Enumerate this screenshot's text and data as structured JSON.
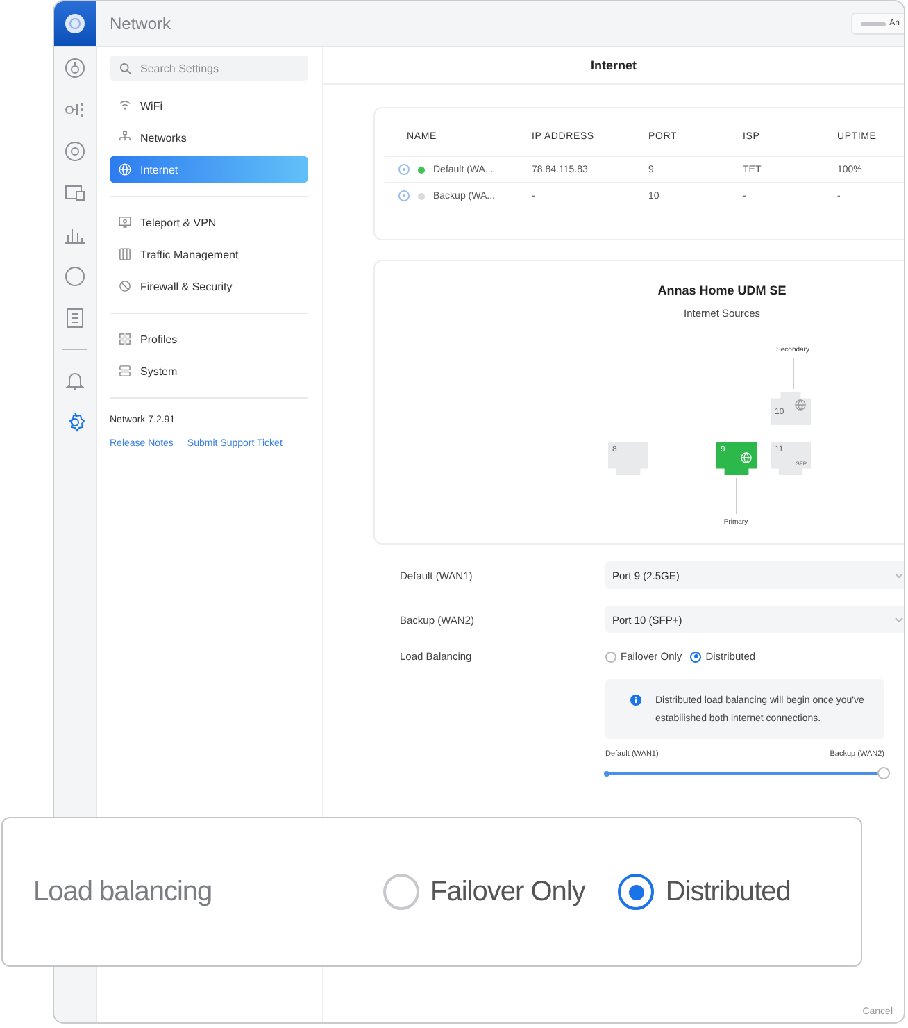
{
  "header": {
    "title": "Network",
    "user": "An"
  },
  "sidebar": {
    "search": {
      "placeholder": "Search Settings"
    },
    "groups": [
      [
        {
          "label": "WiFi",
          "selected": false
        },
        {
          "label": "Networks",
          "selected": false
        },
        {
          "label": "Internet",
          "selected": true
        }
      ],
      [
        {
          "label": "Teleport & VPN",
          "selected": false
        },
        {
          "label": "Traffic Management",
          "selected": false
        },
        {
          "label": "Firewall & Security",
          "selected": false
        }
      ],
      [
        {
          "label": "Profiles",
          "selected": false
        },
        {
          "label": "System",
          "selected": false
        }
      ]
    ],
    "version": "Network 7.2.91",
    "links": [
      "Release Notes",
      "Submit Support Ticket"
    ]
  },
  "content": {
    "title": "Internet",
    "table": {
      "columns": [
        "NAME",
        "IP ADDRESS",
        "PORT",
        "ISP",
        "UPTIME"
      ],
      "rows": [
        {
          "color": "#3ec25a",
          "cells": [
            "Default (WA...",
            "78.84.115.83",
            "9",
            "TET",
            "100%"
          ]
        },
        {
          "color": "#d8dadd",
          "cells": [
            "Backup (WA...",
            "-",
            "10",
            "-",
            "-"
          ]
        }
      ]
    },
    "diagram": {
      "title": "Annas Home UDM SE",
      "subtitle": "Internet Sources",
      "ports": [
        {
          "number": "8",
          "kind": "plain"
        },
        {
          "number": "9",
          "kind": "primary",
          "label": "Primary"
        },
        {
          "number": "10",
          "kind": "secondary",
          "label": "Secondary"
        },
        {
          "number": "11",
          "kind": "plain",
          "tag": "SFP"
        }
      ]
    },
    "form": [
      {
        "label": "Default (WAN1)",
        "value": "Port 9 (2.5GE)"
      },
      {
        "label": "Backup (WAN2)",
        "value": "Port 10 (SFP+)"
      }
    ],
    "load_balancing": {
      "label": "Load Balancing",
      "options": [
        {
          "label": "Failover Only",
          "selected": false
        },
        {
          "label": "Distributed",
          "selected": true
        }
      ],
      "info": "Distributed load balancing will begin once you've estabilished both internet connections.",
      "slider": {
        "left": "Default (WAN1)",
        "right": "Backup (WAN2)",
        "level": 1
      }
    },
    "cancel": "Cancel"
  },
  "zoom_callout": {
    "label": "Load balancing",
    "options": [
      {
        "label": "Failover Only",
        "selected": false
      },
      {
        "label": "Distributed",
        "selected": true
      }
    ]
  }
}
